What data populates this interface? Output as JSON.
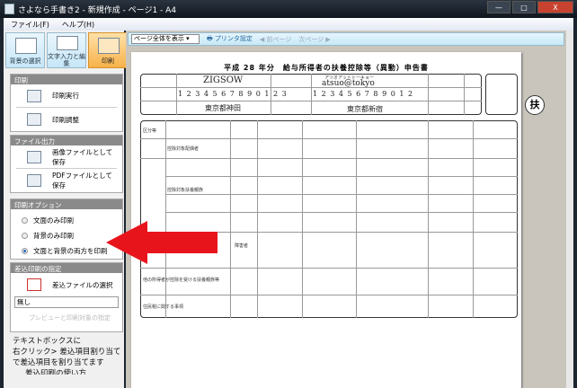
{
  "window": {
    "title": "さよなら手書き2 - 新規作成 - ページ1 - A4",
    "minimize": "—",
    "maximize": "□",
    "close": "X"
  },
  "menu": [
    "ファイル(F)",
    "ヘルプ(H)"
  ],
  "modes": [
    {
      "label": "背景の選択"
    },
    {
      "label": "文字入力と編集"
    },
    {
      "label": "印刷",
      "active": true
    }
  ],
  "sections": {
    "print": {
      "title": "印刷",
      "items": [
        "印刷実行",
        "印刷調整"
      ]
    },
    "file_output": {
      "title": "ファイル出力",
      "items": [
        "画像ファイルとして保存",
        "PDFファイルとして保存"
      ]
    },
    "print_options": {
      "title": "印刷オプション",
      "options": [
        "文面のみ印刷",
        "背景のみ印刷",
        "文面と背景の両方を印刷"
      ],
      "selected": 2
    },
    "merge": {
      "title": "差込印刷の指定",
      "select_file": "差込ファイルの選択",
      "file_value": "無し",
      "preview": "プレビューと印刷対象の指定"
    }
  },
  "help_text": [
    "テキストボックスに",
    "右クリック> 差込項目割り当て",
    "で差込項目を割り当てます",
    "差込印刷の使い方"
  ],
  "toolbar": {
    "zoom_select": "ページ全体を表示",
    "printer_settings": "プリンタ設定",
    "prev_page": "前ページ",
    "next_page": "次ページ"
  },
  "document": {
    "title": "平成 28 年分　給与所得者の扶養控除等（異動）申告書",
    "payer_name": "ZIGSOW",
    "payer_number": "1 2 3 4 5 6 7 8 9 0 1 2 3",
    "payer_address": "東京都神田",
    "furigana": "アツオアットトーキョー",
    "name": "atsuo@tokyo",
    "my_number": "1 2 3 4 5 6 7 8 9 0 1 2",
    "address": "東京都新宿",
    "stamp": "扶",
    "labels": [
      "区分等",
      "控除対象配偶者",
      "控除対象扶養親族",
      "障害者",
      "他の所得者が控除を受ける扶養親族等",
      "住民税に関する事項"
    ]
  },
  "colors": {
    "arrow": "#e8141b",
    "accent": "#f7b24a"
  }
}
